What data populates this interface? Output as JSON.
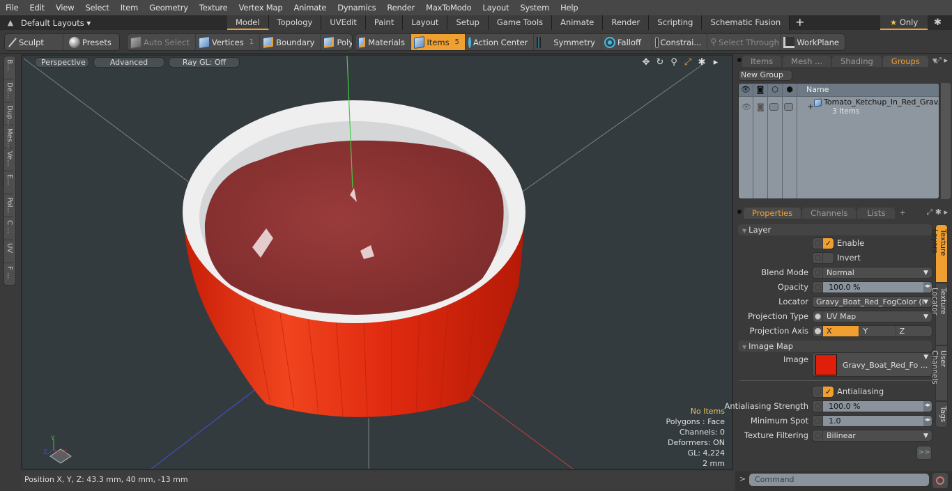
{
  "menu": [
    "File",
    "Edit",
    "View",
    "Select",
    "Item",
    "Geometry",
    "Texture",
    "Vertex Map",
    "Animate",
    "Dynamics",
    "Render",
    "MaxToModo",
    "Layout",
    "System",
    "Help"
  ],
  "layoutbar": {
    "layout_selector": "Default Layouts ▾",
    "tabs": [
      "Model",
      "Topology",
      "UVEdit",
      "Paint",
      "Layout",
      "Setup",
      "Game Tools",
      "Animate",
      "Render",
      "Scripting",
      "Schematic Fusion"
    ],
    "active_tab": "Model",
    "add_tab": "+",
    "only_label": "Only"
  },
  "toolbar": {
    "sculpt": "Sculpt",
    "presets": "Presets",
    "auto_select": "Auto Select",
    "vertices": "Vertices",
    "vertices_count": "1",
    "boundary": "Boundary",
    "polygons": "Polygons",
    "materials": "Materials",
    "items": "Items",
    "items_count": "5",
    "action_center": "Action Center",
    "symmetry": "Symmetry",
    "falloff": "Falloff",
    "constraints": "Constrai...",
    "select_through": "Select Through",
    "workplane": "WorkPlane"
  },
  "left_vtabs": [
    "B...",
    "De...",
    "Dup...",
    "Mes...",
    "Ve...",
    "E...",
    "Pol...",
    "C ...",
    "UV",
    "F ..."
  ],
  "viewport": {
    "view_mode": "Perspective",
    "shading": "Advanced",
    "raygl": "Ray GL: Off",
    "info": {
      "selection": "No Items",
      "polygons": "Polygons : Face",
      "channels": "Channels: 0",
      "deformers": "Deformers: ON",
      "gl": "GL: 4,224",
      "units": "2 mm"
    },
    "axis_labels": {
      "x": "X",
      "y": "Y",
      "z": "Z"
    },
    "colors": {
      "bowl_red": "#e22a10",
      "ketchup": "#8e3535",
      "rim": "#efefef",
      "bg": "#343b3e"
    }
  },
  "status": {
    "position": "Position X, Y, Z:   43.3 mm, 40 mm, -13 mm"
  },
  "groups_panel": {
    "tabs": [
      "Items",
      "Mesh ...",
      "Shading",
      "Groups"
    ],
    "active_tab": "Groups",
    "new_group": "New Group",
    "column_name": "Name",
    "row_title": "Tomato_Ketchup_In_Red_Grav...",
    "row_sub": "3 Items"
  },
  "properties": {
    "tabs": [
      "Properties",
      "Channels",
      "Lists"
    ],
    "active_tab": "Properties",
    "add": "+",
    "layer_header": "Layer",
    "enable": "Enable",
    "invert": "Invert",
    "blend_mode_label": "Blend Mode",
    "blend_mode": "Normal",
    "opacity_label": "Opacity",
    "opacity": "100.0 %",
    "locator_label": "Locator",
    "locator": "Gravy_Boat_Red_FogColor (I...",
    "projection_type_label": "Projection Type",
    "projection_type": "UV Map",
    "projection_axis_label": "Projection Axis",
    "axes": [
      "X",
      "Y",
      "Z"
    ],
    "active_axis": "X",
    "image_map_header": "Image Map",
    "image_label": "Image",
    "image": "Gravy_Boat_Red_Fo ...",
    "image_swatch_color": "#e01f0a",
    "antialiasing": "Antialiasing",
    "aa_strength_label": "Antialiasing Strength",
    "aa_strength": "100.0 %",
    "min_spot_label": "Minimum Spot",
    "min_spot": "1.0",
    "filtering_label": "Texture Filtering",
    "filtering": "Bilinear",
    "more": ">>",
    "side_tabs": [
      "Texture Layers",
      "Texture Locator",
      "User Channels",
      "Tags"
    ]
  },
  "command": {
    "prompt": ">",
    "placeholder": "Command"
  }
}
